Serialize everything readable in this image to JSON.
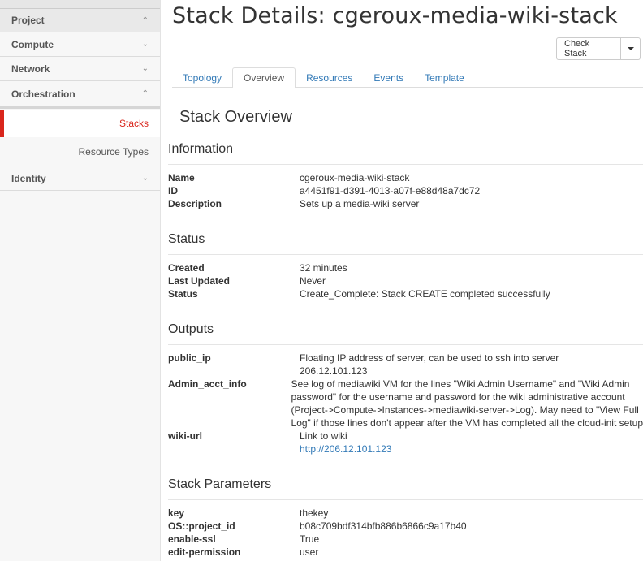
{
  "sidebar": {
    "project": "Project",
    "compute": "Compute",
    "network": "Network",
    "orchestration": "Orchestration",
    "stacks": "Stacks",
    "resource_types": "Resource Types",
    "identity": "Identity"
  },
  "page": {
    "title": "Stack Details: cgeroux-media-wiki-stack",
    "check_stack": "Check Stack"
  },
  "tabs": [
    "Topology",
    "Overview",
    "Resources",
    "Events",
    "Template"
  ],
  "overview": {
    "heading": "Stack Overview",
    "information": {
      "heading": "Information",
      "rows": [
        {
          "k": "Name",
          "v": "cgeroux-media-wiki-stack"
        },
        {
          "k": "ID",
          "v": "a4451f91-d391-4013-a07f-e88d48a7dc72"
        },
        {
          "k": "Description",
          "v": "Sets up a media-wiki server"
        }
      ]
    },
    "status": {
      "heading": "Status",
      "rows": [
        {
          "k": "Created",
          "v": "32 minutes"
        },
        {
          "k": "Last Updated",
          "v": "Never"
        },
        {
          "k": "Status",
          "v": "Create_Complete: Stack CREATE completed successfully"
        }
      ]
    },
    "outputs": {
      "heading": "Outputs",
      "public_ip_key": "public_ip",
      "public_ip_desc": "Floating IP address of server, can be used to ssh into server",
      "public_ip_val": "206.12.101.123",
      "admin_key": "Admin_acct_info",
      "admin_l1": "See log of mediawiki VM for the lines \"Wiki Admin Username\" and \"Wiki Admin",
      "admin_l2": "password\" for the username and password for the wiki administrative account",
      "admin_l3": "(Project->Compute->Instances->mediawiki-server->Log). May need to \"View Full",
      "admin_l4": "Log\" if those lines don't appear after the VM has completed all the cloud-init setup",
      "wiki_key": "wiki-url",
      "wiki_desc": "Link to wiki",
      "wiki_link": "http://206.12.101.123"
    },
    "params": {
      "heading": "Stack Parameters",
      "rows": [
        {
          "k": "key",
          "v": "thekey"
        },
        {
          "k": "OS::project_id",
          "v": "b08c709bdf314bfb886b6866c9a17b40"
        },
        {
          "k": "enable-ssl",
          "v": "True"
        },
        {
          "k": "edit-permission",
          "v": "user"
        }
      ]
    }
  },
  "colors": {
    "accent": "#d9261c",
    "link": "#337ab7"
  }
}
